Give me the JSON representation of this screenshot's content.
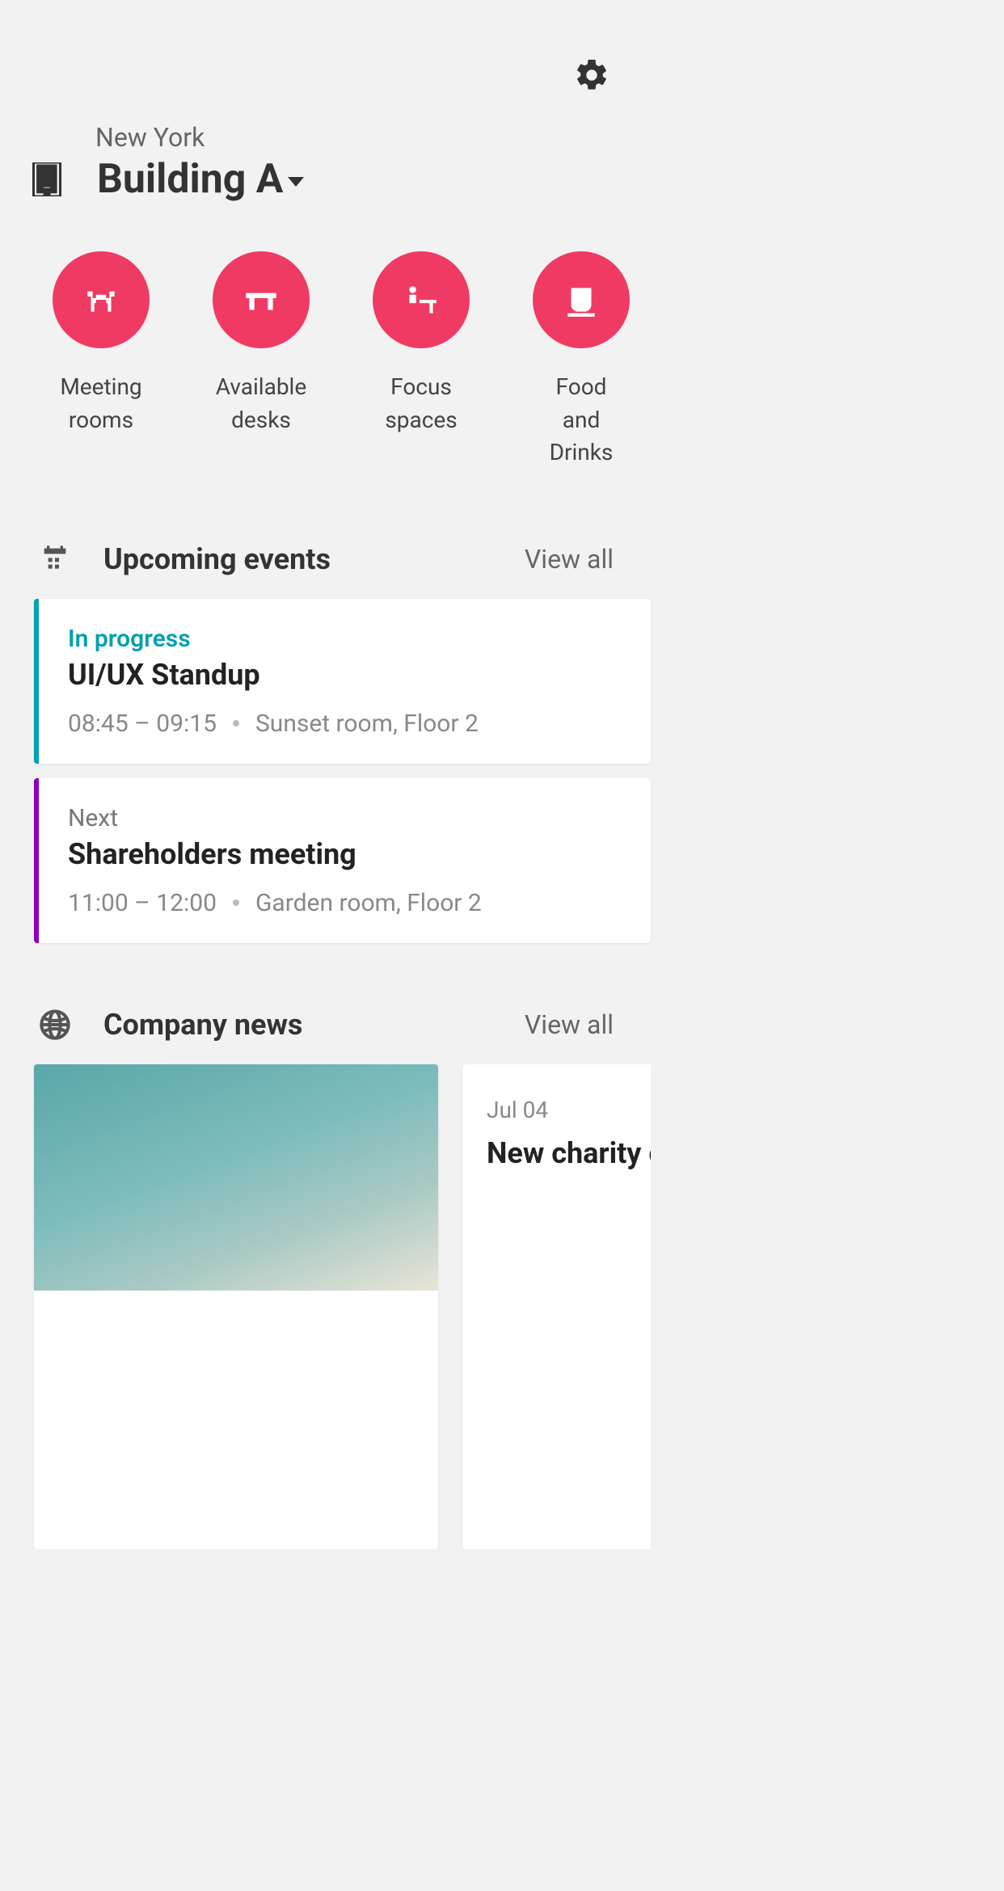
{
  "location": {
    "city": "New York",
    "building": "Building A"
  },
  "quick_actions": [
    {
      "id": "meeting-rooms",
      "label": "Meeting\nrooms",
      "icon": "chair-table-icon"
    },
    {
      "id": "available-desks",
      "label": "Available\ndesks",
      "icon": "desk-icon"
    },
    {
      "id": "focus-spaces",
      "label": "Focus\nspaces",
      "icon": "focus-desk-icon"
    },
    {
      "id": "food-drinks",
      "label": "Food\nand Drinks",
      "icon": "cup-icon"
    }
  ],
  "events_section": {
    "title": "Upcoming events",
    "view_all": "View all"
  },
  "events": [
    {
      "status_label": "In progress",
      "status_kind": "progress",
      "accent": "#00a0b0",
      "title": "UI/UX Standup",
      "time": "08:45 – 09:15",
      "location": "Sunset room, Floor 2"
    },
    {
      "status_label": "Next",
      "status_kind": "next",
      "accent": "#8a00c2",
      "title": "Shareholders meeting",
      "time": "11:00 – 12:00",
      "location": "Garden room, Floor 2"
    }
  ],
  "news_section": {
    "title": "Company news",
    "view_all": "View all"
  },
  "news": [
    {
      "date": "",
      "title": "",
      "has_image": true
    },
    {
      "date": "Jul 04",
      "title": "New charity c",
      "has_image": false
    }
  ]
}
